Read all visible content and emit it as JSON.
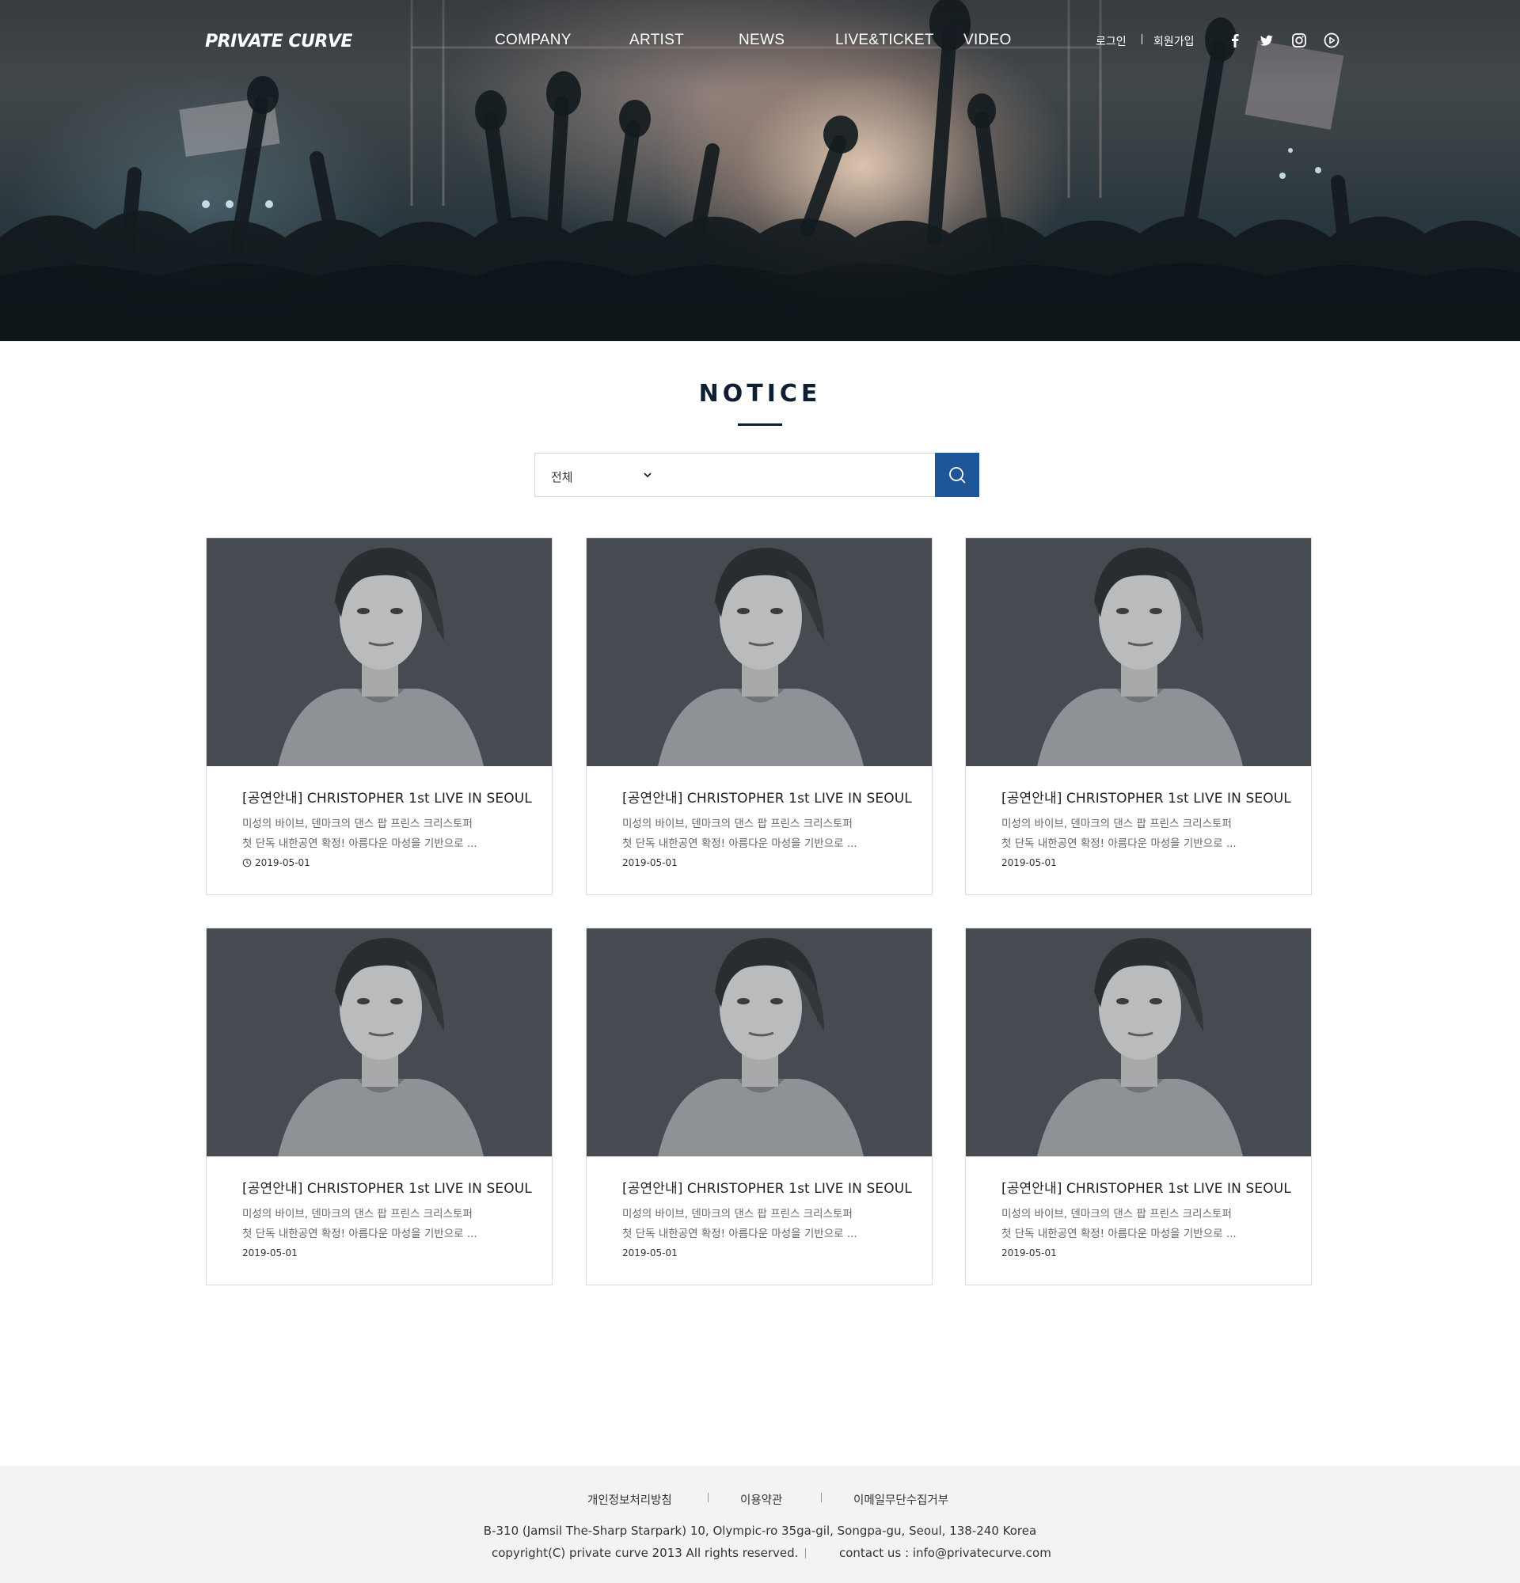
{
  "header": {
    "logo": "PRIVATE CURVE",
    "nav": [
      "COMPANY",
      "ARTIST",
      "NEWS",
      "LIVE&TICKET",
      "VIDEO"
    ],
    "login": "로그인",
    "signup": "회원가입",
    "social_icons": [
      "facebook-icon",
      "twitter-icon",
      "instagram-icon",
      "youtube-icon"
    ]
  },
  "notice": {
    "title": "NOTICE",
    "search": {
      "selected_category": "전체",
      "placeholder": "",
      "button_icon": "search-icon"
    },
    "accent_color": "#1e5596",
    "cards": [
      {
        "title": "[공연안내]  CHRISTOPHER 1st LIVE IN SEOUL",
        "desc_line1": "미성의 바이브, 덴마크의 댄스 팝 프린스 크리스토퍼",
        "desc_line2": "첫 단독 내한공연 확정! 아름다운 마성을 기반으로 ...",
        "date": "2019-05-01"
      },
      {
        "title": "[공연안내]  CHRISTOPHER 1st LIVE IN SEOUL",
        "desc_line1": "미성의 바이브, 덴마크의 댄스 팝 프린스 크리스토퍼",
        "desc_line2": "첫 단독 내한공연 확정! 아름다운 마성을 기반으로 ...",
        "date": "2019-05-01"
      },
      {
        "title": "[공연안내]  CHRISTOPHER 1st LIVE IN SEOUL",
        "desc_line1": "미성의 바이브, 덴마크의 댄스 팝 프린스 크리스토퍼",
        "desc_line2": "첫 단독 내한공연 확정! 아름다운 마성을 기반으로 ...",
        "date": "2019-05-01"
      },
      {
        "title": "[공연안내]  CHRISTOPHER 1st LIVE IN SEOUL",
        "desc_line1": "미성의 바이브, 덴마크의 댄스 팝 프린스 크리스토퍼",
        "desc_line2": "첫 단독 내한공연 확정! 아름다운 마성을 기반으로 ...",
        "date": "2019-05-01"
      },
      {
        "title": "[공연안내]  CHRISTOPHER 1st LIVE IN SEOUL",
        "desc_line1": "미성의 바이브, 덴마크의 댄스 팝 프린스 크리스토퍼",
        "desc_line2": "첫 단독 내한공연 확정! 아름다운 마성을 기반으로 ...",
        "date": "2019-05-01"
      },
      {
        "title": "[공연안내]  CHRISTOPHER 1st LIVE IN SEOUL",
        "desc_line1": "미성의 바이브, 덴마크의 댄스 팝 프린스 크리스토퍼",
        "desc_line2": "첫 단독 내한공연 확정! 아름다운 마성을 기반으로 ...",
        "date": "2019-05-01"
      }
    ]
  },
  "footer": {
    "links": [
      "개인정보처리방침",
      "이용약관",
      "이메일무단수집거부"
    ],
    "address": "B-310 (Jamsil The-Sharp Starpark) 10, Olympic-ro 35ga-gil, Songpa-gu, Seoul, 138-240 Korea",
    "copyright": "copyright(C) private curve 2013 All rights reserved.",
    "contact": "contact us : info@privatecurve.com"
  }
}
